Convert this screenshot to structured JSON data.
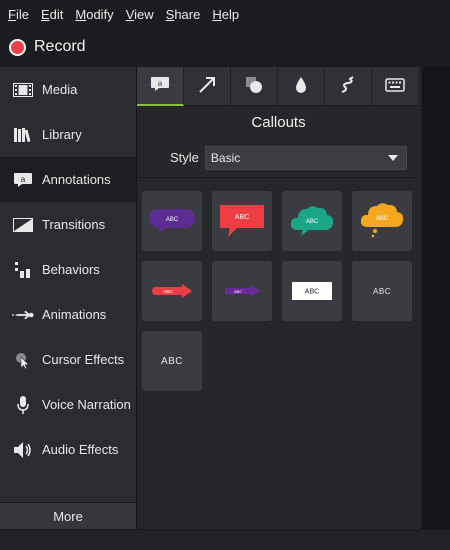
{
  "menu": {
    "items": [
      {
        "key": "F",
        "rest": "ile"
      },
      {
        "key": "E",
        "rest": "dit"
      },
      {
        "key": "M",
        "rest": "odify"
      },
      {
        "key": "V",
        "rest": "iew"
      },
      {
        "key": "S",
        "rest": "hare"
      },
      {
        "key": "H",
        "rest": "elp"
      }
    ]
  },
  "record": {
    "label": "Record"
  },
  "sidebar": {
    "items": [
      {
        "label": "Media",
        "icon": "film-strip-icon"
      },
      {
        "label": "Library",
        "icon": "books-icon"
      },
      {
        "label": "Annotations",
        "icon": "callout-icon"
      },
      {
        "label": "Transitions",
        "icon": "transition-icon"
      },
      {
        "label": "Behaviors",
        "icon": "behaviors-icon"
      },
      {
        "label": "Animations",
        "icon": "animation-arrow-icon"
      },
      {
        "label": "Cursor Effects",
        "icon": "cursor-effects-icon"
      },
      {
        "label": "Voice Narration",
        "icon": "microphone-icon"
      },
      {
        "label": "Audio Effects",
        "icon": "speaker-icon"
      }
    ],
    "more_label": "More"
  },
  "panel": {
    "tabs": [
      "callouts-tab-icon",
      "arrow-tab-icon",
      "shape-tab-icon",
      "blur-tab-icon",
      "sketch-tab-icon",
      "keyboard-tab-icon"
    ],
    "title": "Callouts",
    "style_label": "Style",
    "style_value": "Basic",
    "tiles": [
      {
        "text": "ABC",
        "shape": "speech-bubble",
        "color": "#5b2c91"
      },
      {
        "text": "ABC",
        "shape": "rect-callout",
        "color": "#ee3e44"
      },
      {
        "text": "ABC",
        "shape": "cloud",
        "color": "#1ba688"
      },
      {
        "text": "ABC",
        "shape": "thought-cloud",
        "color": "#f4a81e"
      },
      {
        "text": "ABC",
        "shape": "arrow",
        "color": "#ee3e44"
      },
      {
        "text": "ABC",
        "shape": "arrow",
        "color": "#6a2a9a"
      },
      {
        "text": "ABC",
        "shape": "box",
        "color": "#ffffff"
      },
      {
        "text": "ABC",
        "shape": "text",
        "color": "#e4e4e4"
      },
      {
        "text": "ABC",
        "shape": "text-large",
        "color": "#e4e4e4"
      }
    ]
  }
}
